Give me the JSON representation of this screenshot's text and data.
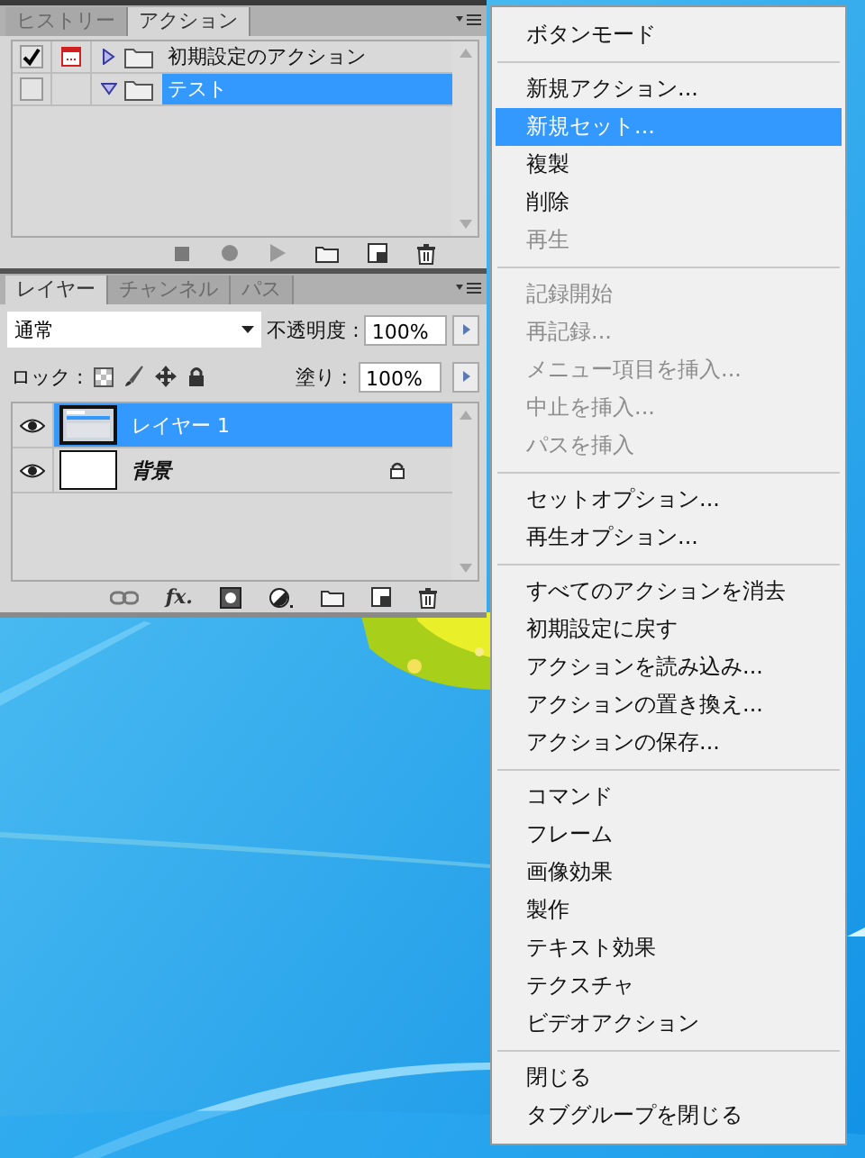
{
  "actions_panel": {
    "tabs": [
      {
        "label": "ヒストリー",
        "selected": false
      },
      {
        "label": "アクション",
        "selected": true
      }
    ],
    "actions": [
      {
        "name": "初期設定のアクション",
        "checked": true,
        "dialog": true,
        "expanded": false,
        "selected": false
      },
      {
        "name": "テスト",
        "checked": false,
        "dialog": false,
        "expanded": true,
        "selected": true
      }
    ]
  },
  "layers_panel": {
    "tabs": [
      {
        "label": "レイヤー",
        "selected": true
      },
      {
        "label": "チャンネル",
        "selected": false
      },
      {
        "label": "パス",
        "selected": false
      }
    ],
    "blend_mode": "通常",
    "opacity_label": "不透明度 :",
    "opacity": "100%",
    "lock_label": "ロック :",
    "fill_label": "塗り :",
    "fill": "100%",
    "fx_label": "fx.",
    "layers": [
      {
        "kind": "layer",
        "name": "レイヤー 1",
        "visible": true,
        "selected": true
      },
      {
        "kind": "background",
        "name": "背景",
        "visible": true,
        "selected": false
      }
    ]
  },
  "menu": {
    "items": [
      {
        "kind": "item",
        "label": "ボタンモード",
        "disabled": false,
        "selected": false
      },
      {
        "kind": "separator"
      },
      {
        "kind": "item",
        "label": "新規アクション...",
        "disabled": false,
        "selected": false
      },
      {
        "kind": "item",
        "label": "新規セット...",
        "disabled": false,
        "selected": true
      },
      {
        "kind": "item",
        "label": "複製",
        "disabled": false,
        "selected": false
      },
      {
        "kind": "item",
        "label": "削除",
        "disabled": false,
        "selected": false
      },
      {
        "kind": "item",
        "label": "再生",
        "disabled": true,
        "selected": false
      },
      {
        "kind": "separator"
      },
      {
        "kind": "item",
        "label": "記録開始",
        "disabled": true,
        "selected": false
      },
      {
        "kind": "item",
        "label": "再記録...",
        "disabled": true,
        "selected": false
      },
      {
        "kind": "item",
        "label": "メニュー項目を挿入...",
        "disabled": true,
        "selected": false
      },
      {
        "kind": "item",
        "label": "中止を挿入...",
        "disabled": true,
        "selected": false
      },
      {
        "kind": "item",
        "label": "パスを挿入",
        "disabled": true,
        "selected": false
      },
      {
        "kind": "separator"
      },
      {
        "kind": "item",
        "label": "セットオプション...",
        "disabled": false,
        "selected": false
      },
      {
        "kind": "item",
        "label": "再生オプション...",
        "disabled": false,
        "selected": false
      },
      {
        "kind": "separator"
      },
      {
        "kind": "item",
        "label": "すべてのアクションを消去",
        "disabled": false,
        "selected": false
      },
      {
        "kind": "item",
        "label": "初期設定に戻す",
        "disabled": false,
        "selected": false
      },
      {
        "kind": "item",
        "label": "アクションを読み込み...",
        "disabled": false,
        "selected": false
      },
      {
        "kind": "item",
        "label": "アクションの置き換え...",
        "disabled": false,
        "selected": false
      },
      {
        "kind": "item",
        "label": "アクションの保存...",
        "disabled": false,
        "selected": false
      },
      {
        "kind": "separator"
      },
      {
        "kind": "item",
        "label": "コマンド",
        "disabled": false,
        "selected": false
      },
      {
        "kind": "item",
        "label": "フレーム",
        "disabled": false,
        "selected": false
      },
      {
        "kind": "item",
        "label": "画像効果",
        "disabled": false,
        "selected": false
      },
      {
        "kind": "item",
        "label": "製作",
        "disabled": false,
        "selected": false
      },
      {
        "kind": "item",
        "label": "テキスト効果",
        "disabled": false,
        "selected": false
      },
      {
        "kind": "item",
        "label": "テクスチャ",
        "disabled": false,
        "selected": false
      },
      {
        "kind": "item",
        "label": "ビデオアクション",
        "disabled": false,
        "selected": false
      },
      {
        "kind": "separator"
      },
      {
        "kind": "item",
        "label": "閉じる",
        "disabled": false,
        "selected": false
      },
      {
        "kind": "item",
        "label": "タブグループを閉じる",
        "disabled": false,
        "selected": false
      }
    ]
  }
}
